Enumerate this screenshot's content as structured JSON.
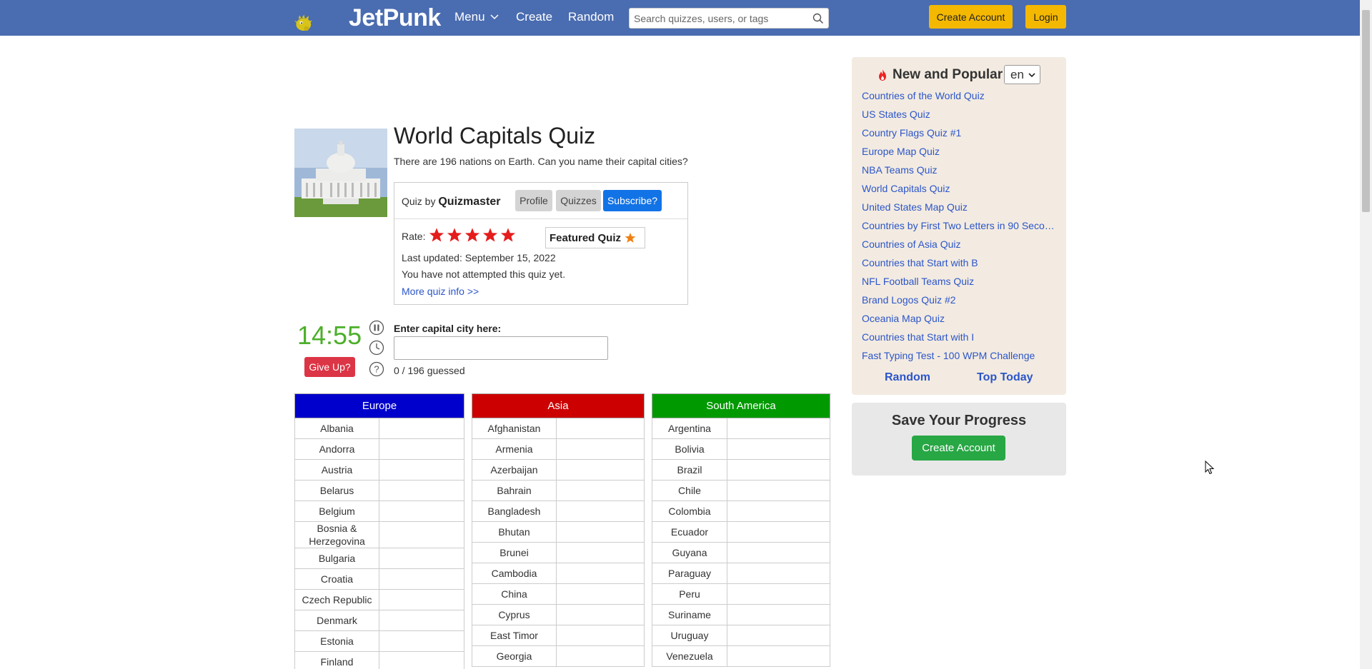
{
  "header": {
    "logo_text": "JetPunk",
    "nav": {
      "menu": "Menu",
      "create": "Create",
      "random": "Random"
    },
    "search_placeholder": "Search quizzes, users, or tags",
    "create_account": "Create Account",
    "login": "Login"
  },
  "quiz": {
    "title": "World Capitals Quiz",
    "description": "There are 196 nations on Earth. Can you name their capital cities?",
    "quiz_by_label": "Quiz by",
    "author": "Quizmaster",
    "profile_btn": "Profile",
    "quizzes_btn": "Quizzes",
    "subscribe_btn": "Subscribe?",
    "rate_label": "Rate:",
    "featured": "Featured Quiz",
    "last_updated": "Last updated: September 15, 2022",
    "attempt_status": "You have not attempted this quiz yet.",
    "more_info": "More quiz info >>"
  },
  "game": {
    "timer": "14:55",
    "give_up": "Give Up?",
    "input_label": "Enter capital city here:",
    "input_value": "",
    "guessed": "0 / 196 guessed"
  },
  "regions": [
    {
      "name": "Europe",
      "color": "#0000cc",
      "countries": [
        "Albania",
        "Andorra",
        "Austria",
        "Belarus",
        "Belgium",
        "Bosnia & Herzegovina",
        "Bulgaria",
        "Croatia",
        "Czech Republic",
        "Denmark",
        "Estonia",
        "Finland"
      ]
    },
    {
      "name": "Asia",
      "color": "#cc0000",
      "countries": [
        "Afghanistan",
        "Armenia",
        "Azerbaijan",
        "Bahrain",
        "Bangladesh",
        "Bhutan",
        "Brunei",
        "Cambodia",
        "China",
        "Cyprus",
        "East Timor",
        "Georgia"
      ]
    },
    {
      "name": "South America",
      "color": "#009900",
      "countries": [
        "Argentina",
        "Bolivia",
        "Brazil",
        "Chile",
        "Colombia",
        "Ecuador",
        "Guyana",
        "Paraguay",
        "Peru",
        "Suriname",
        "Uruguay",
        "Venezuela"
      ]
    }
  ],
  "sidebar": {
    "new_popular_title": "New and Popular",
    "language": "en",
    "popular": [
      "Countries of the World Quiz",
      "US States Quiz",
      "Country Flags Quiz #1",
      "Europe Map Quiz",
      "NBA Teams Quiz",
      "World Capitals Quiz",
      "United States Map Quiz",
      "Countries by First Two Letters in 90 Seco…",
      "Countries of Asia Quiz",
      "Countries that Start with B",
      "NFL Football Teams Quiz",
      "Brand Logos Quiz #2",
      "Oceania Map Quiz",
      "Countries that Start with I",
      "Fast Typing Test - 100 WPM Challenge"
    ],
    "random": "Random",
    "top_today": "Top Today",
    "save_title": "Save Your Progress",
    "save_button": "Create Account"
  }
}
